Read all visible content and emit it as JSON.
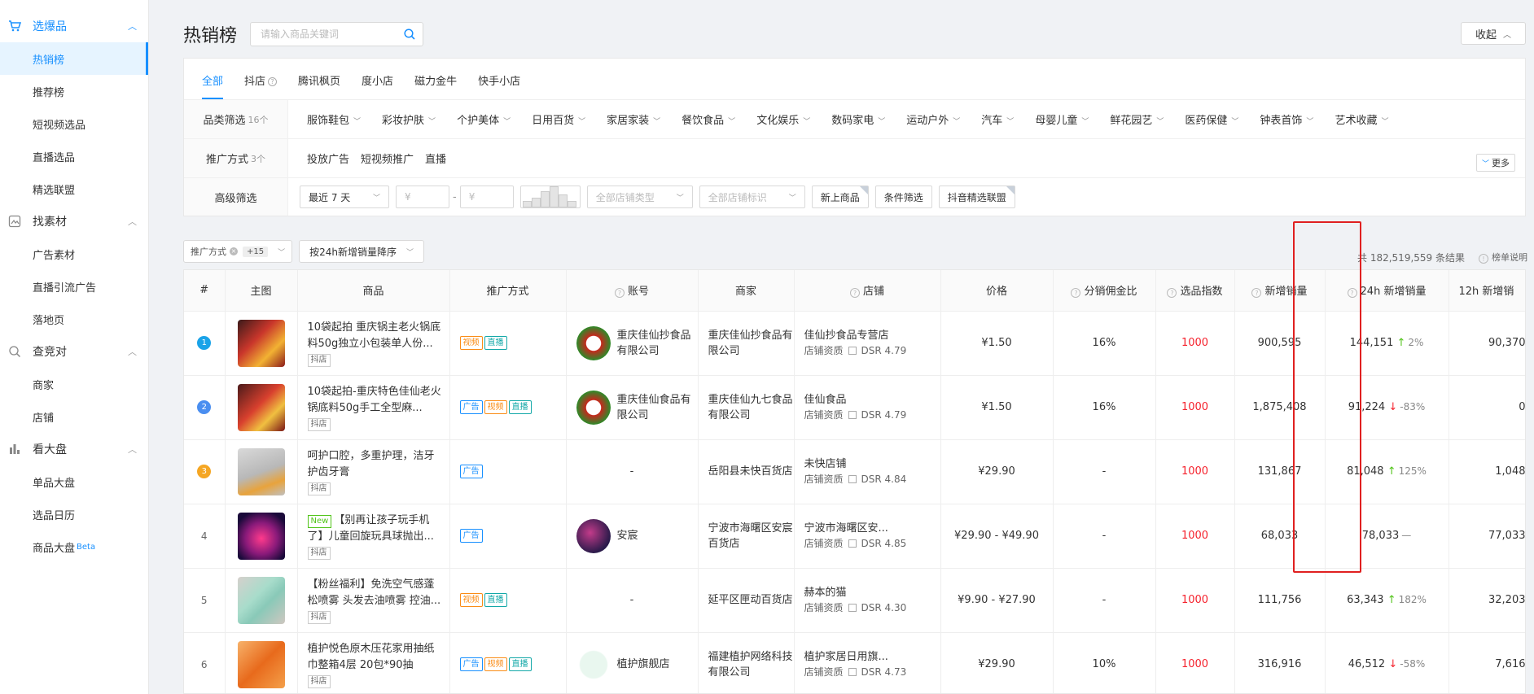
{
  "sidebar": {
    "sections": [
      {
        "label": "选爆品",
        "icon": "cart-icon",
        "items": [
          "热销榜",
          "推荐榜",
          "短视频选品",
          "直播选品",
          "精选联盟"
        ]
      },
      {
        "label": "找素材",
        "icon": "material-icon",
        "items": [
          "广告素材",
          "直播引流广告",
          "落地页"
        ]
      },
      {
        "label": "查竞对",
        "icon": "competitor-icon",
        "items": [
          "商家",
          "店铺"
        ]
      },
      {
        "label": "看大盘",
        "icon": "bar-chart-icon",
        "items": [
          "单品大盘",
          "选品日历",
          "商品大盘"
        ]
      }
    ],
    "beta": "Beta"
  },
  "header": {
    "title": "热销榜",
    "search_placeholder": "请输入商品关键词",
    "collapse_label": "收起"
  },
  "tabs": [
    "全部",
    "抖店",
    "腾讯枫页",
    "度小店",
    "磁力金牛",
    "快手小店"
  ],
  "filters": {
    "category": {
      "label": "品类筛选",
      "count": "16个",
      "options": [
        "服饰鞋包",
        "彩妆护肤",
        "个护美体",
        "日用百货",
        "家居家装",
        "餐饮食品",
        "文化娱乐",
        "数码家电",
        "运动户外",
        "汽车",
        "母婴儿童",
        "鲜花园艺",
        "医药保健",
        "钟表首饰",
        "艺术收藏"
      ],
      "more": "更多"
    },
    "promo": {
      "label": "推广方式",
      "count": "3个",
      "options": [
        "投放广告",
        "短视频推广",
        "直播"
      ]
    },
    "advanced": {
      "label": "高级筛选",
      "period": "最近 7 天",
      "price_min": "¥",
      "price_max": "¥",
      "dash": "-",
      "store_type": "全部店铺类型",
      "store_mark": "全部店铺标识",
      "new_goods": "新上商品",
      "conditions": "条件筛选",
      "alliance": "抖音精选联盟"
    }
  },
  "toolbar": {
    "chip": "推广方式",
    "chip_count": "+15",
    "sort": "按24h新增销量降序",
    "total": "共 182,519,559 条结果",
    "rank_explain": "榜单说明"
  },
  "columns": [
    "#",
    "主图",
    "商品",
    "推广方式",
    "账号",
    "商家",
    "店铺",
    "价格",
    "分销佣金比",
    "选品指数",
    "新增销量",
    "24h 新增销量",
    "12h 新增销"
  ],
  "colors": {
    "accent": "#1890ff",
    "rank1": "#1aa3e8",
    "rank2": "#4a8ef0",
    "rank3": "#f5a623",
    "highlight_box": "#e02020"
  },
  "rows": [
    {
      "rank": "1",
      "title": "10袋起拍 重庆锅主老火锅底料50g独立小包装单人份...",
      "new": "",
      "platform": "抖店",
      "tags": [
        "视频",
        "直播"
      ],
      "account": "重庆佳仙抄食品有限公司",
      "merchant": "重庆佳仙抄食品有限公司",
      "shop": "佳仙抄食品专营店",
      "shop_sub": "店铺资质",
      "dsr": "DSR 4.79",
      "price": "¥1.50",
      "commission": "16%",
      "index": "1000",
      "new_sales": "900,595",
      "sales24": "144,151",
      "trend": "up",
      "change": "2%",
      "sales12": "90,370"
    },
    {
      "rank": "2",
      "title": "10袋起拍-重庆特色佳仙老火锅底料50g手工全型麻...",
      "new": "",
      "platform": "抖店",
      "tags": [
        "广告",
        "视频",
        "直播"
      ],
      "account": "重庆佳仙食品有限公司",
      "merchant": "重庆佳仙九七食品有限公司",
      "shop": "佳仙食品",
      "shop_sub": "店铺资质",
      "dsr": "DSR 4.79",
      "price": "¥1.50",
      "commission": "16%",
      "index": "1000",
      "new_sales": "1,875,408",
      "sales24": "91,224",
      "trend": "down",
      "change": "-83%",
      "sales12": "0"
    },
    {
      "rank": "3",
      "title": "呵护口腔，多重护理，洁牙护齿牙膏",
      "new": "",
      "platform": "抖店",
      "tags": [
        "广告"
      ],
      "account": "-",
      "merchant": "岳阳县未快百货店",
      "shop": "未快店铺",
      "shop_sub": "店铺资质",
      "dsr": "DSR 4.84",
      "price": "¥29.90",
      "commission": "-",
      "index": "1000",
      "new_sales": "131,867",
      "sales24": "81,048",
      "trend": "up",
      "change": "125%",
      "sales12": "1,048"
    },
    {
      "rank": "4",
      "title": "【别再让孩子玩手机了】儿童回旋玩具球抛出...",
      "new": "New",
      "platform": "抖店",
      "tags": [
        "广告"
      ],
      "account": "安宸",
      "merchant": "宁波市海曙区安宸百货店",
      "shop": "宁波市海曙区安...",
      "shop_sub": "店铺资质",
      "dsr": "DSR 4.85",
      "price": "¥29.90 - ¥49.90",
      "commission": "-",
      "index": "1000",
      "new_sales": "68,033",
      "sales24": "78,033",
      "trend": "flat",
      "change": "—",
      "sales12": "77,033"
    },
    {
      "rank": "5",
      "title": "【粉丝福利】免洗空气感蓬松喷雾 头发去油喷雾 控油...",
      "new": "",
      "platform": "抖店",
      "tags": [
        "视频",
        "直播"
      ],
      "account": "-",
      "merchant": "延平区匣动百货店",
      "shop": "赫本的猫",
      "shop_sub": "店铺资质",
      "dsr": "DSR 4.30",
      "price": "¥9.90 - ¥27.90",
      "commission": "-",
      "index": "1000",
      "new_sales": "111,756",
      "sales24": "63,343",
      "trend": "up",
      "change": "182%",
      "sales12": "32,203"
    },
    {
      "rank": "6",
      "title": "植护悦色原木压花家用抽纸巾整箱4层 20包*90抽",
      "new": "",
      "platform": "抖店",
      "tags": [
        "广告",
        "视频",
        "直播"
      ],
      "account": "植护旗舰店",
      "merchant": "福建植护网络科技有限公司",
      "shop": "植护家居日用旗...",
      "shop_sub": "店铺资质",
      "dsr": "DSR 4.73",
      "price": "¥29.90",
      "commission": "10%",
      "index": "1000",
      "new_sales": "316,916",
      "sales24": "46,512",
      "trend": "down",
      "change": "-58%",
      "sales12": "7,616"
    }
  ]
}
